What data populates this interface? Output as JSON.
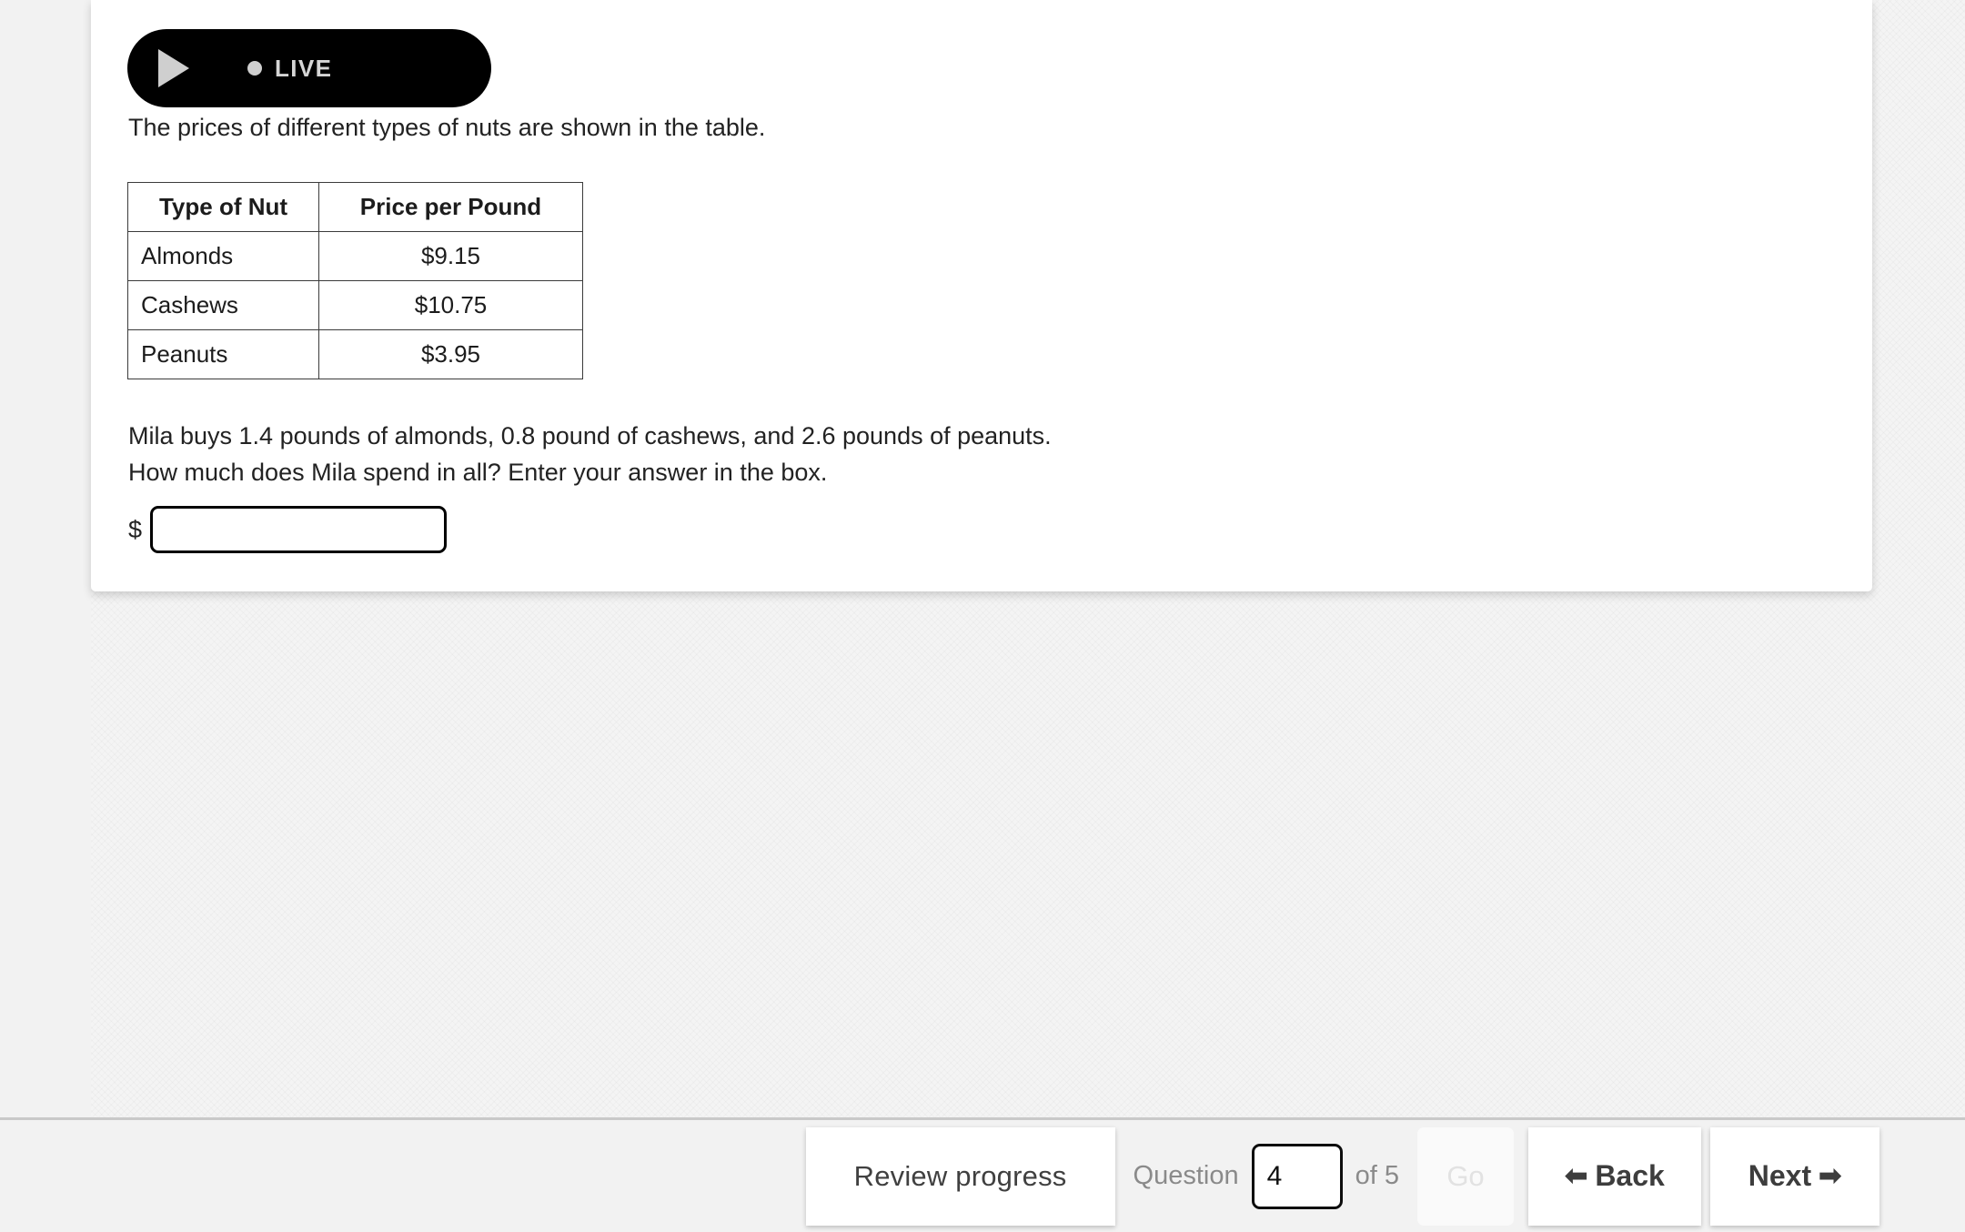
{
  "media": {
    "play_icon": "play-icon",
    "status_dot_icon": "live-status-dot-icon",
    "live_label": "LIVE",
    "pill_color": "#000000",
    "pill_text_color": "#d5d5d5"
  },
  "question": {
    "intro_text": "The prices of different types of nuts are shown in the table.",
    "prompt_line_1": "Mila buys 1.4 pounds of almonds, 0.8 pound of cashews, and 2.6 pounds of peanuts.",
    "prompt_line_2": "How much does Mila spend in all? Enter your answer in the box.",
    "answer": {
      "currency_symbol": "$",
      "value": "",
      "placeholder": ""
    }
  },
  "table": {
    "headers": [
      "Type of Nut",
      "Price per Pound"
    ],
    "rows": [
      {
        "nut": "Almonds",
        "price": "$9.15"
      },
      {
        "nut": "Cashews",
        "price": "$10.75"
      },
      {
        "nut": "Peanuts",
        "price": "$3.95"
      }
    ]
  },
  "toolbar": {
    "review_progress_label": "Review progress",
    "question_word": "Question",
    "question_number": "4",
    "of_label": "of 5",
    "total_questions": "5",
    "go_label": "Go",
    "go_enabled": false,
    "back_label": "Back",
    "back_icon": "arrow-left-icon",
    "back_arrow_glyph": "⬅",
    "next_label": "Next",
    "next_icon": "arrow-right-icon",
    "next_arrow_glyph": "➡"
  },
  "theme": {
    "page_background": "#f2f2f2",
    "card_background": "#ffffff",
    "toolbar_background": "#f2f2f2",
    "toolbar_border": "#c9c9c9",
    "text_color": "#222222",
    "muted_text_color": "#8a8a8a",
    "disabled_text_color": "#e2e2e2"
  }
}
